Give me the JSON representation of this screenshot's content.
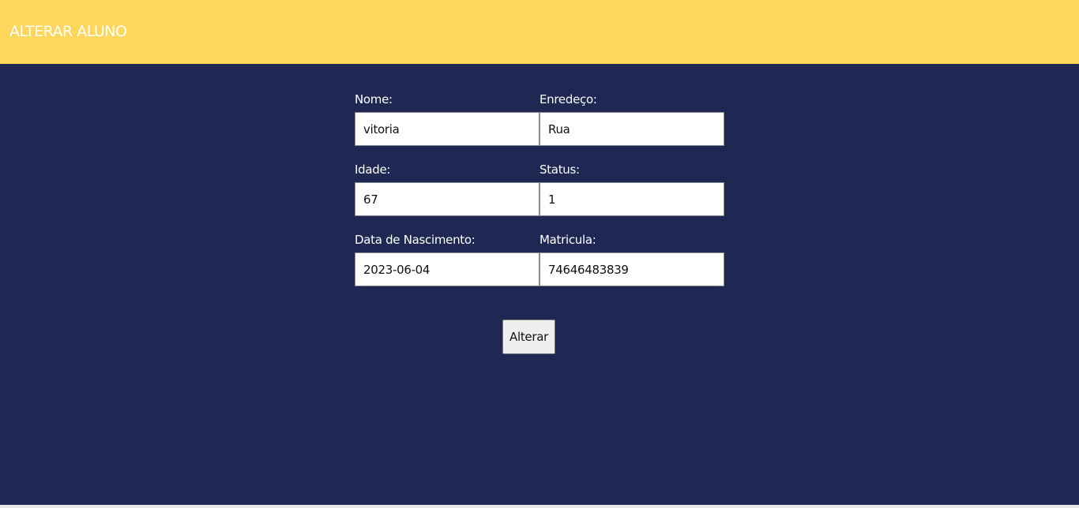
{
  "header": {
    "title": "ALTERAR ALUNO",
    "background_color": "#ffd65c"
  },
  "page": {
    "background_color": "#1e2853"
  },
  "form": {
    "nome": {
      "label": "Nome:",
      "value": "vitoria"
    },
    "endereco": {
      "label": "Enredeço:",
      "value": "Rua"
    },
    "idade": {
      "label": "Idade:",
      "value": "67"
    },
    "status": {
      "label": "Status:",
      "value": "1"
    },
    "data_nascimento": {
      "label": "Data de Nascimento:",
      "value": "2023-06-04"
    },
    "matricula": {
      "label": "Matricula:",
      "value": "74646483839"
    },
    "submit_label": "Alterar"
  }
}
